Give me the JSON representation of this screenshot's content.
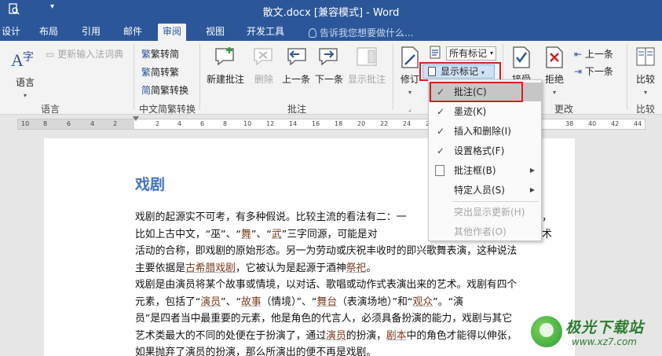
{
  "window": {
    "title": "散文.docx [兼容模式] - Word"
  },
  "tabs": [
    "设计",
    "布局",
    "引用",
    "邮件",
    "审阅",
    "视图",
    "开发工具"
  ],
  "active_tab": "审阅",
  "tell_me": "告诉我您想要做什么...",
  "ribbon": {
    "language": {
      "update_ime": "更新输入法词典",
      "language_btn": "语言",
      "group": "语言"
    },
    "chinese_conversion": {
      "trad_to_simp": "繁转简",
      "simp_to_trad": "简转繁",
      "convert": "简繁转换",
      "group": "中文简繁转换"
    },
    "comments": {
      "new": "新建批注",
      "delete": "删除",
      "previous": "上一条",
      "next": "下一条",
      "show": "显示批注",
      "group": "批注"
    },
    "tracking": {
      "track": "修订",
      "markup_select": "所有标记",
      "show_markup": "显示标记"
    },
    "changes": {
      "accept": "接受",
      "reject": "拒绝",
      "previous": "上一条",
      "next": "下一条",
      "group": "更改"
    },
    "compare": {
      "compare": "比较",
      "group": "比较"
    }
  },
  "ruler_ticks": [
    "10",
    "8",
    "6",
    "4",
    "2",
    "",
    "2",
    "4",
    "6",
    "8",
    "10",
    "12",
    "14",
    "16",
    "18",
    "20",
    "22",
    "24",
    "26",
    "28",
    "30",
    "32",
    "34",
    "36",
    "38",
    "40",
    "42",
    "44",
    "46",
    "48"
  ],
  "document": {
    "heading": "戏剧",
    "p1_l1": "戏剧的起源实不可考，有多种假说。比较主流的看法有二：一",
    "p1_l1_end": "，",
    "p1_l2a": "比如上古中文，“巫”、“",
    "p1_l2b": "舞",
    "p1_l2c": "”、“",
    "p1_l2d": "武",
    "p1_l2e": "”三字同源，可能是对",
    "p1_l2_end": "术",
    "p1_l3": "活动的合称，即戏剧的原始形态。另一为劳动或庆祝丰收时的即兴歌舞表演，这种说法",
    "p1_l4a": "主要依据是",
    "p1_l4b": "古希腊戏剧",
    "p1_l4c": "，它被认为是起源于酒神",
    "p1_l4d": "祭祀",
    "p1_l4e": "。",
    "p2_l1": "戏剧是由演员将某个故事或情境，以对话、歌唱或动作式表演出来的艺术。戏剧有四个",
    "p2_l2a": "元素，包括了“",
    "p2_l2b": "演员",
    "p2_l2c": "”、“",
    "p2_l2d": "故事",
    "p2_l2e": "（情境）”、“",
    "p2_l2f": "舞台",
    "p2_l2g": "（表演场地）”和“",
    "p2_l2h": "观众",
    "p2_l2i": "”。“演",
    "p2_l3": "员”是四者当中最重要的元素，他是角色的代言人，必须具备扮演的能力，戏剧与其它",
    "p2_l4a": "艺术类最大的不同的处便在于扮演了，通过",
    "p2_l4b": "演员",
    "p2_l4c": "的扮演，",
    "p2_l4d": "剧本",
    "p2_l4e": "中的角色才能得以伸张，",
    "p2_l5": "如果抛弃了演员的扮演，那么所演出的便不再是戏剧。"
  },
  "menu": {
    "items": [
      {
        "label": "批注(C)",
        "checked": true
      },
      {
        "label": "墨迹(K)",
        "checked": true
      },
      {
        "label": "插入和删除(I)",
        "checked": true
      },
      {
        "label": "设置格式(F)",
        "checked": true
      },
      {
        "label": "批注框(B)",
        "submenu": true
      },
      {
        "label": "特定人员(S)",
        "submenu": true
      },
      {
        "label": "突出显示更新(H)",
        "disabled": true
      },
      {
        "label": "其他作者(O)",
        "disabled": true
      }
    ]
  },
  "watermark": {
    "name": "极光下载站",
    "url": "www.xz7.com"
  },
  "colors": {
    "title_bar": "#2b579a",
    "highlight_box": "#d12020",
    "heading": "#4472c4"
  }
}
